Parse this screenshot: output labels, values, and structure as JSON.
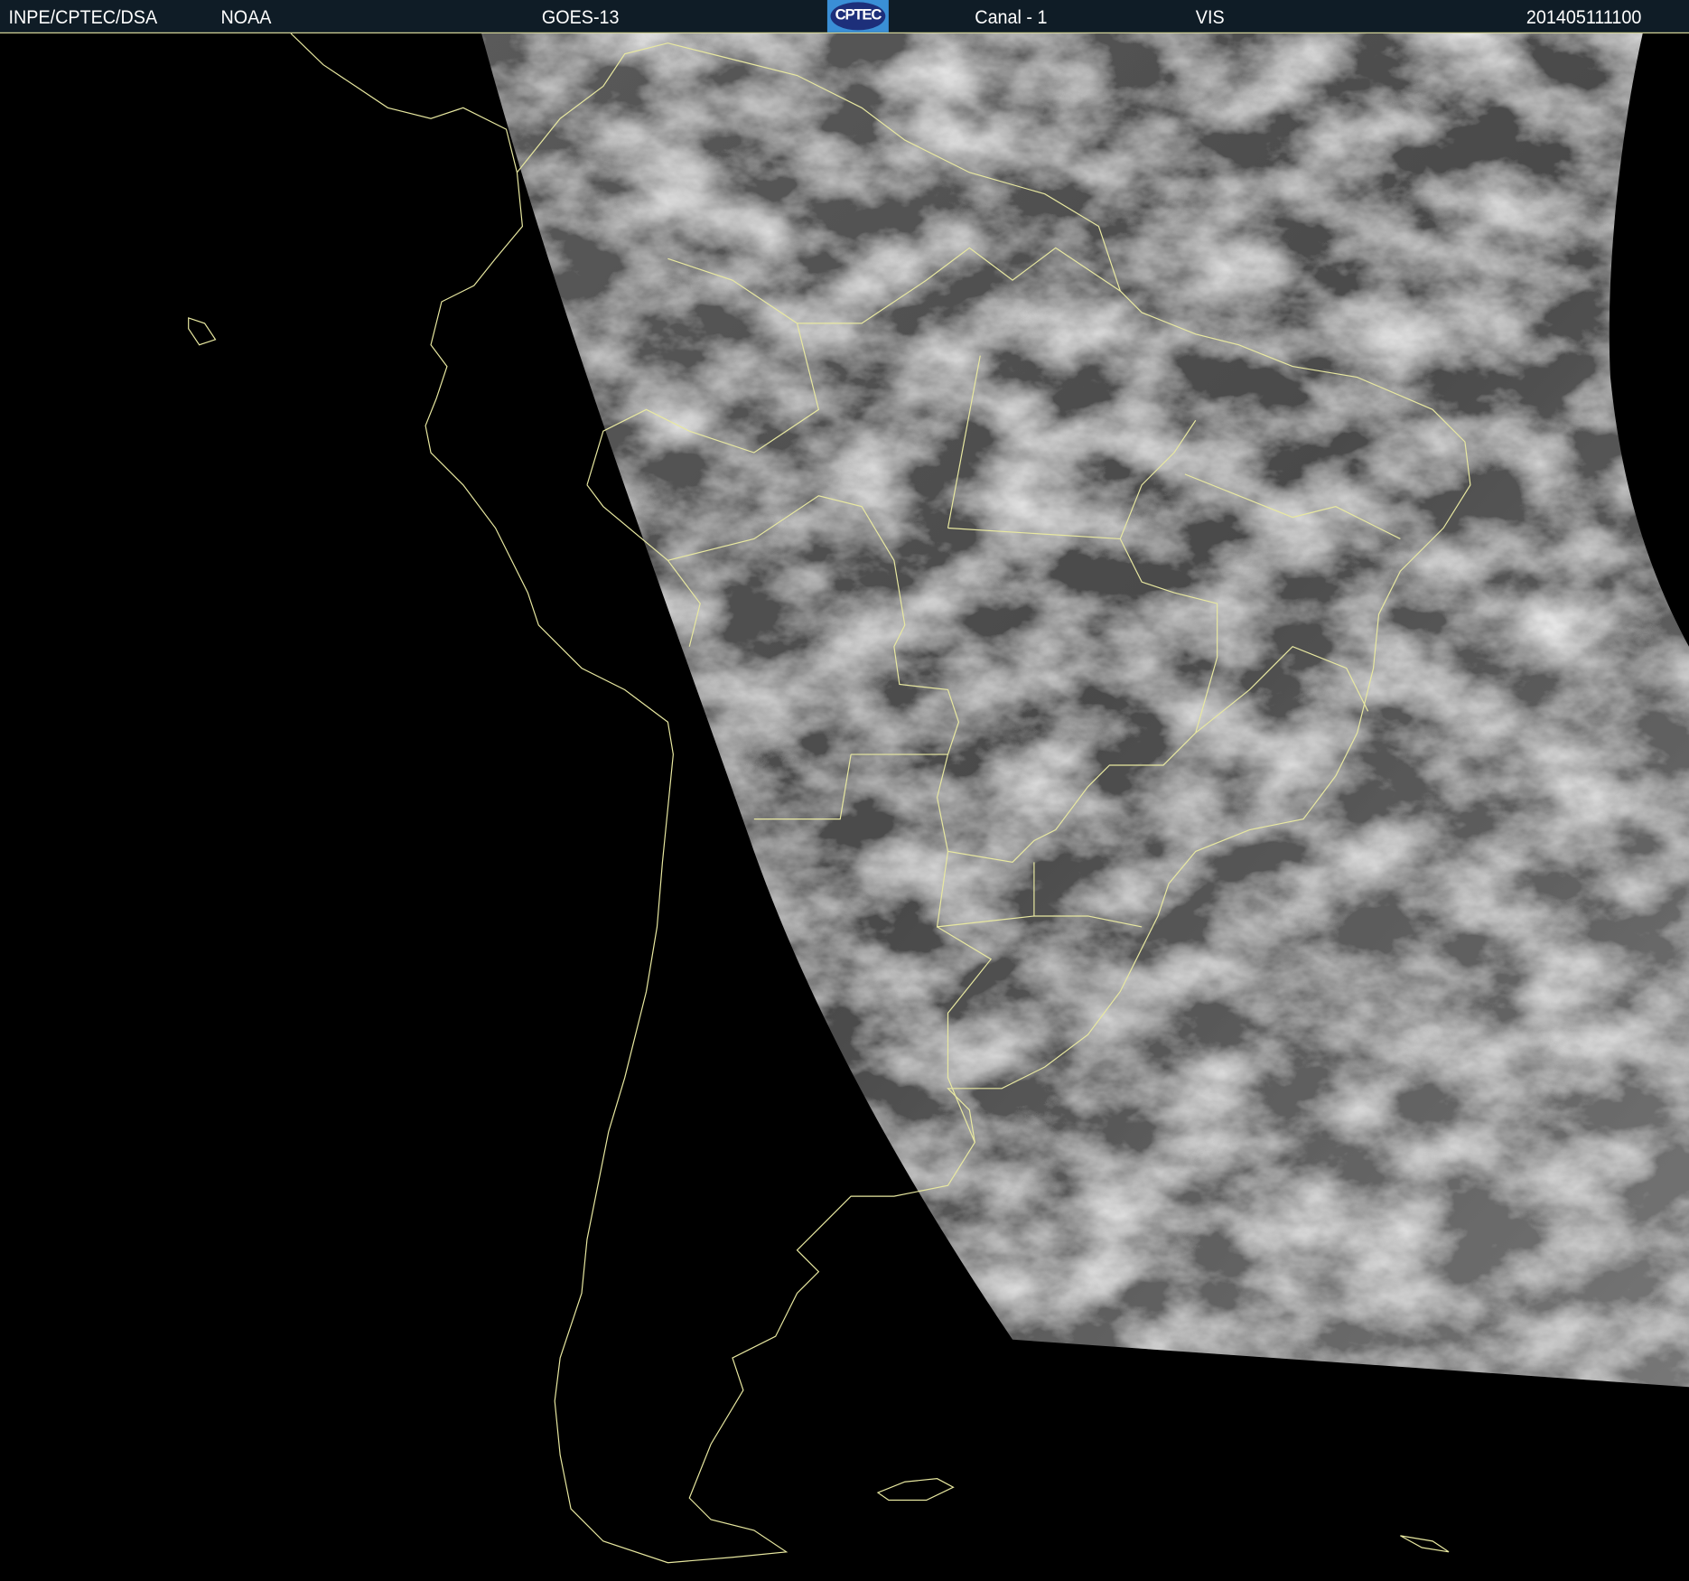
{
  "header": {
    "institution": "INPE/CPTEC/DSA",
    "agency": "NOAA",
    "satellite": "GOES-13",
    "logo_text": "CPTEC",
    "channel": "Canal - 1",
    "band": "VIS",
    "timestamp": "201405111100"
  },
  "colors": {
    "header_bg": "#0f1c26",
    "border_lines": "#e8e8a0"
  }
}
